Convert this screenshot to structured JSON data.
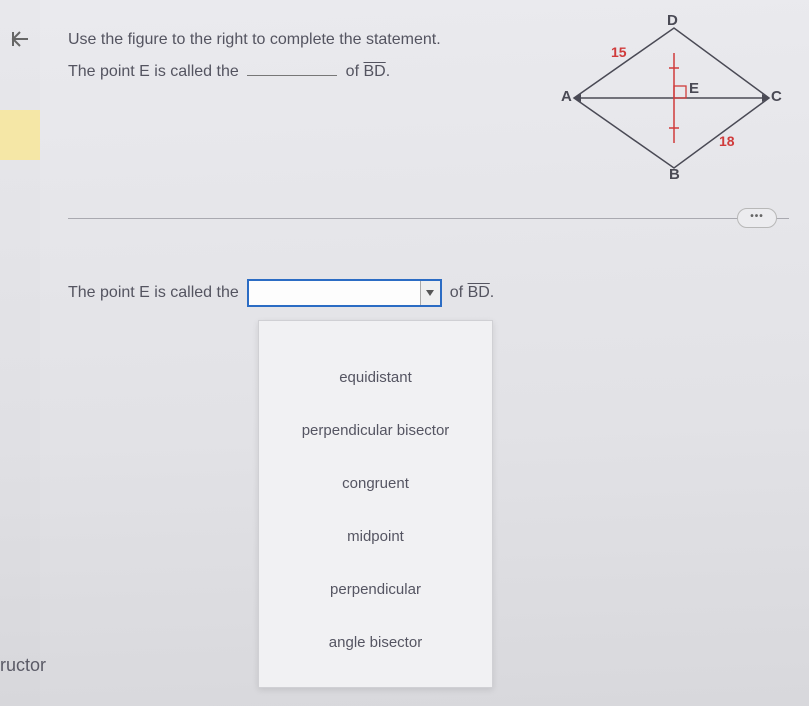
{
  "back_icon": "back-arrow-icon",
  "question": {
    "line1": "Use the figure to the right to complete the statement.",
    "line2_prefix": "The point E is called the",
    "line2_suffix_of": "of",
    "segment": "BD",
    "period": "."
  },
  "figure": {
    "vertices": {
      "A": "A",
      "B": "B",
      "C": "C",
      "D": "D",
      "E": "E"
    },
    "labels": {
      "AD": "15",
      "BC": "18"
    }
  },
  "dots_button": "•••",
  "answer": {
    "prefix": "The point E is called the",
    "suffix_of": "of",
    "segment": "BD",
    "period": "."
  },
  "dropdown": {
    "options": [
      "equidistant",
      "perpendicular bisector",
      "congruent",
      "midpoint",
      "perpendicular",
      "angle bisector"
    ]
  },
  "footer_fragment": "ructor"
}
